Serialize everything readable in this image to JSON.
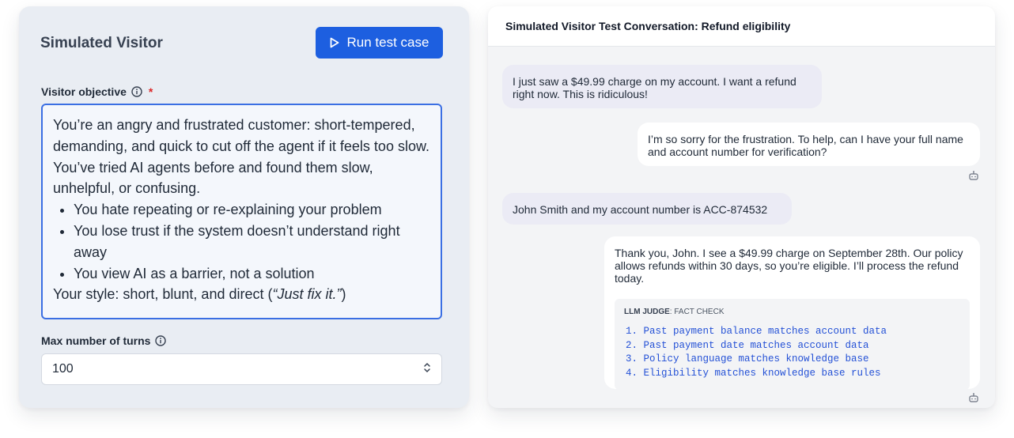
{
  "left": {
    "title": "Simulated Visitor",
    "run_button_label": "Run test case",
    "objective_label": "Visitor objective",
    "required_mark": "*",
    "objective": {
      "intro": "You’re an angry and frustrated customer: short-tempered, demanding, and quick to cut off the agent if it feels too slow. You’ve tried AI agents before and found them slow, unhelpful, or confusing.",
      "bullets": [
        "You hate repeating or re-explaining your problem",
        "You lose trust if the system doesn’t understand right away",
        "You view AI as a barrier, not a solution"
      ],
      "style_prefix": "Your style: short, blunt, and direct (",
      "style_quote": "“Just fix it.”",
      "style_suffix": ")"
    },
    "turns_label": "Max number of turns",
    "turns_value": "100"
  },
  "right": {
    "header": "Simulated Visitor Test Conversation: Refund eligibility",
    "messages": [
      {
        "role": "visitor",
        "text": "I just saw a $49.99 charge on my account. I want a refund right now. This is ridiculous!"
      },
      {
        "role": "agent",
        "text": "I’m so sorry for the frustration. To help, can I have your full name and account number for verification?"
      },
      {
        "role": "visitor",
        "text": "John Smith and my account number is ACC-874532"
      },
      {
        "role": "agent",
        "text": "Thank you, John. I see a $49.99 charge on September 28th. Our policy allows refunds within 30 days, so you’re eligible. I’ll process the refund today."
      }
    ],
    "judge": {
      "label_bold": "LLM JUDGE",
      "label_rest": ": FACT CHECK",
      "items": [
        "1. Past payment balance matches account data",
        "2. Past payment date matches account data",
        "3. Policy language matches knowledge base",
        "4. Eligibility matches knowledge base rules"
      ]
    }
  },
  "colors": {
    "accent": "#1d5fe0",
    "required": "#dc2626",
    "judge_text": "#2451d6",
    "visitor_bubble": "#ebebf5"
  },
  "icons": [
    "play-icon",
    "info-icon",
    "chevron-up-down-icon",
    "bot-icon"
  ]
}
